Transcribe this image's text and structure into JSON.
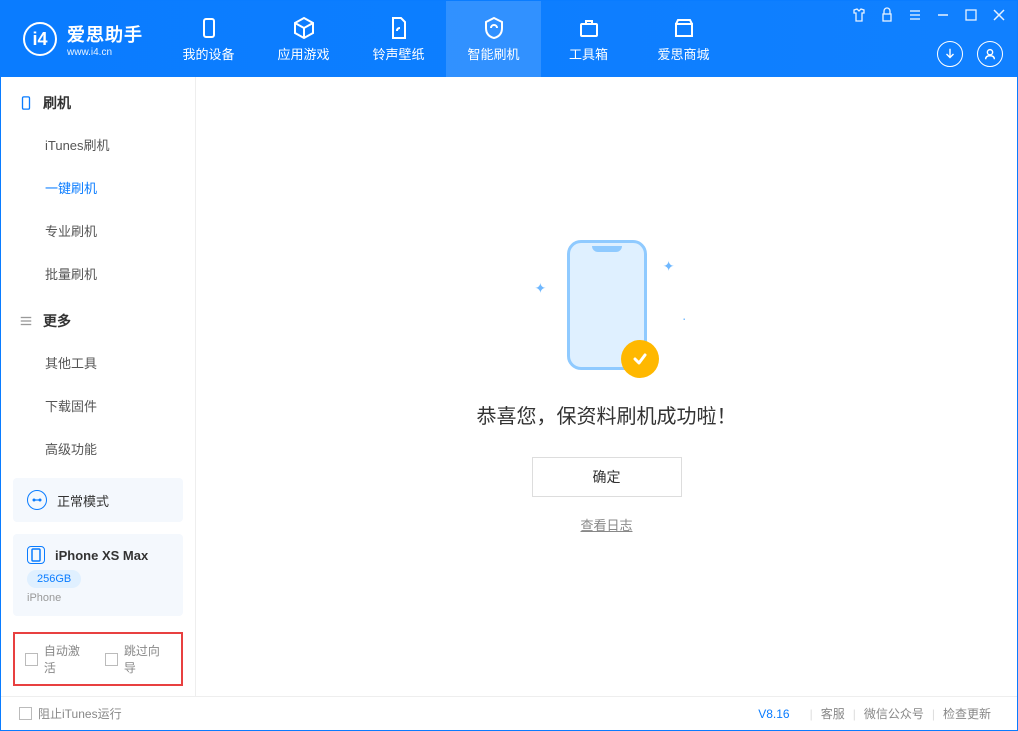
{
  "app": {
    "title": "爱思助手",
    "subtitle": "www.i4.cn"
  },
  "nav": [
    {
      "label": "我的设备"
    },
    {
      "label": "应用游戏"
    },
    {
      "label": "铃声壁纸"
    },
    {
      "label": "智能刷机"
    },
    {
      "label": "工具箱"
    },
    {
      "label": "爱思商城"
    }
  ],
  "sidebar": {
    "section1": {
      "title": "刷机",
      "items": [
        "iTunes刷机",
        "一键刷机",
        "专业刷机",
        "批量刷机"
      ]
    },
    "section2": {
      "title": "更多",
      "items": [
        "其他工具",
        "下载固件",
        "高级功能"
      ]
    }
  },
  "mode": {
    "label": "正常模式"
  },
  "device": {
    "name": "iPhone XS Max",
    "storage": "256GB",
    "type": "iPhone"
  },
  "options": {
    "auto_activate": "自动激活",
    "skip_guide": "跳过向导"
  },
  "main": {
    "success_text": "恭喜您，保资料刷机成功啦！",
    "ok_button": "确定",
    "view_log": "查看日志"
  },
  "footer": {
    "block_itunes": "阻止iTunes运行",
    "version": "V8.16",
    "links": [
      "客服",
      "微信公众号",
      "检查更新"
    ]
  }
}
